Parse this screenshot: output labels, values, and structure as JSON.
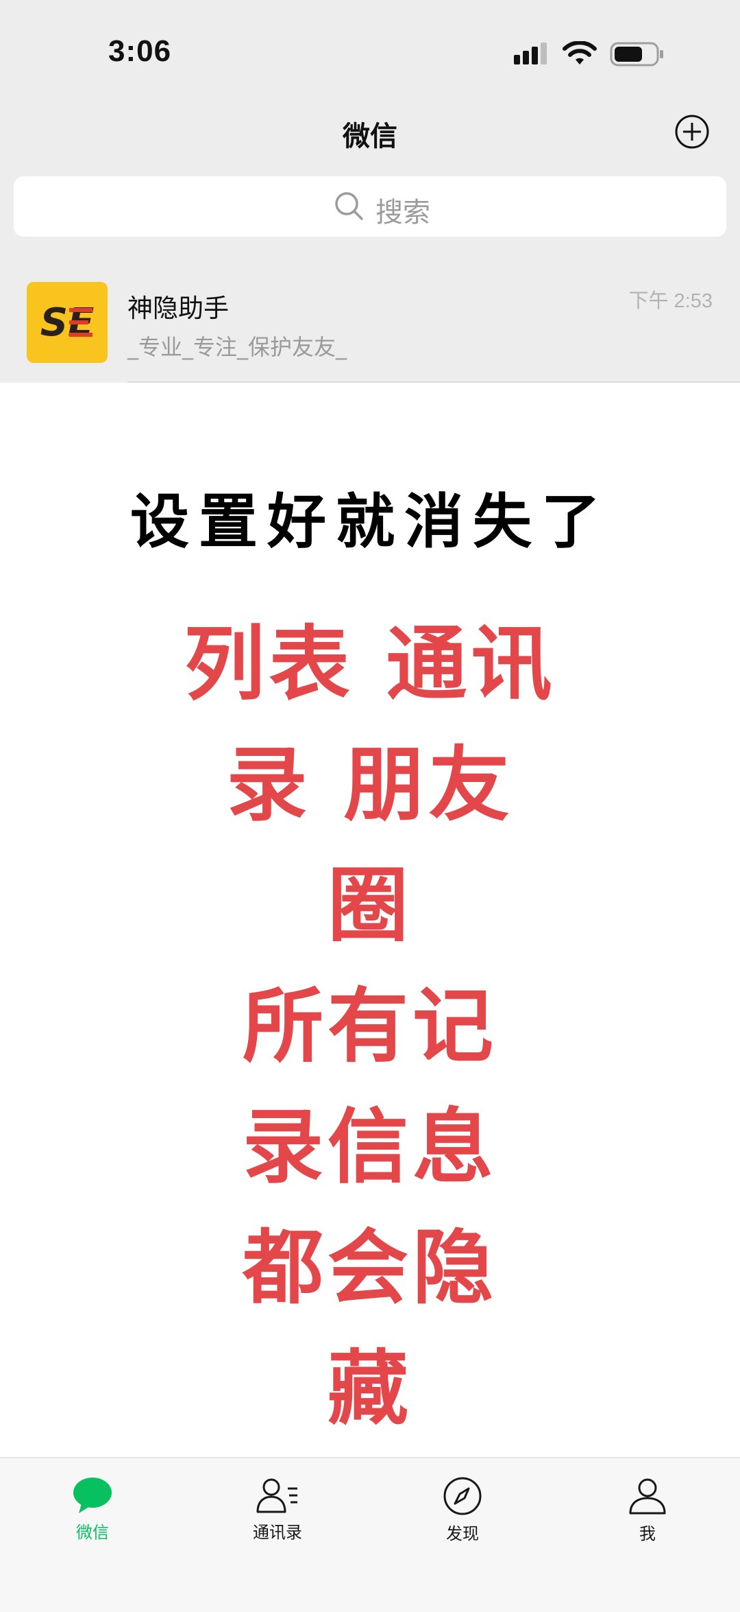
{
  "status_bar": {
    "time": "3:06"
  },
  "nav": {
    "title": "微信"
  },
  "search": {
    "placeholder": "搜索"
  },
  "chat_list": [
    {
      "name": "神隐助手",
      "preview": "_专业_专注_保护友友_",
      "time": "下午 2:53",
      "avatar_text": "SE"
    }
  ],
  "promo": {
    "headline": "设置好就消失了",
    "lines": [
      "列表 通讯",
      "录 朋友",
      "圈",
      "所有记",
      "录信息",
      "都会隐",
      "藏"
    ]
  },
  "tabs": [
    {
      "label": "微信",
      "icon": "chat-bubble-icon",
      "active": true
    },
    {
      "label": "通讯录",
      "icon": "contacts-icon",
      "active": false
    },
    {
      "label": "发现",
      "icon": "compass-icon",
      "active": false
    },
    {
      "label": "我",
      "icon": "person-icon",
      "active": false
    }
  ],
  "colors": {
    "accent": "#07c160",
    "promo_red": "#e4474a",
    "avatar_bg": "#f9c41d"
  }
}
